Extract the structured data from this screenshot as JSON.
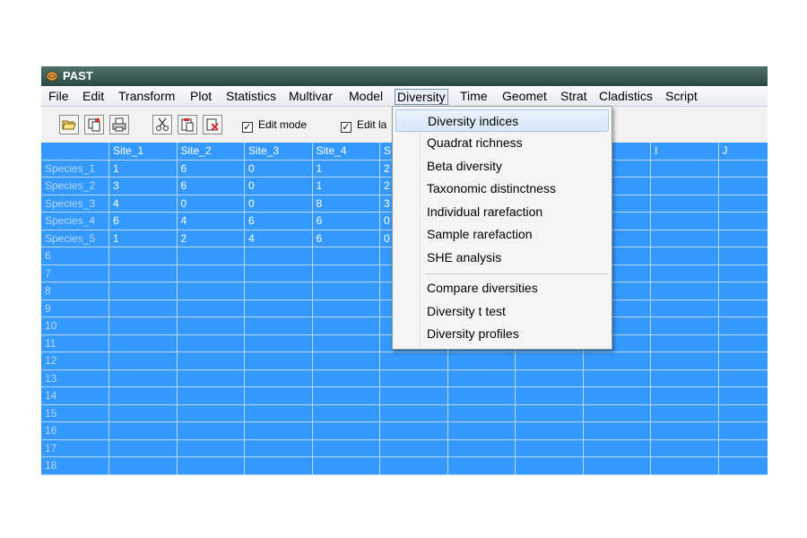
{
  "window": {
    "title": "PAST"
  },
  "menubar": {
    "items": [
      "File",
      "Edit",
      "Transform",
      "Plot",
      "Statistics",
      "Multivar",
      "Model",
      "Diversity",
      "Time",
      "Geomet",
      "Strat",
      "Cladistics",
      "Script"
    ],
    "active": "Diversity"
  },
  "toolbar": {
    "buttons": [
      "open-folder-icon",
      "copy-icon",
      "print-icon",
      "cut-icon",
      "paste-icon",
      "delete-icon"
    ],
    "edit_mode_label": "Edit mode",
    "edit_labels_label": "Edit la",
    "edit_mode_checked": true,
    "edit_labels_checked": true
  },
  "grid": {
    "columns": [
      "Site_1",
      "Site_2",
      "Site_3",
      "Site_4",
      "S",
      "",
      "",
      "",
      "I",
      "J"
    ],
    "row_labels": [
      "Species_1",
      "Species_2",
      "Species_3",
      "Species_4",
      "Species_5",
      "6",
      "7",
      "8",
      "9",
      "10",
      "11",
      "12",
      "13",
      "14",
      "15",
      "16",
      "17",
      "18"
    ],
    "rows": [
      [
        "1",
        "6",
        "0",
        "1",
        "2"
      ],
      [
        "3",
        "6",
        "0",
        "1",
        "2"
      ],
      [
        "4",
        "0",
        "0",
        "8",
        "3"
      ],
      [
        "6",
        "4",
        "6",
        "6",
        "0"
      ],
      [
        "1",
        "2",
        "4",
        "6",
        "0"
      ]
    ],
    "colors": {
      "cell_bg": "#3399ff",
      "text": "#ffffff"
    }
  },
  "dropdown": {
    "group1": [
      "Diversity indices",
      "Quadrat richness",
      "Beta diversity",
      "Taxonomic distinctness",
      "Individual rarefaction",
      "Sample rarefaction",
      "SHE analysis"
    ],
    "group2": [
      "Compare diversities",
      "Diversity t test",
      "Diversity profiles"
    ],
    "selected": "Diversity indices"
  }
}
